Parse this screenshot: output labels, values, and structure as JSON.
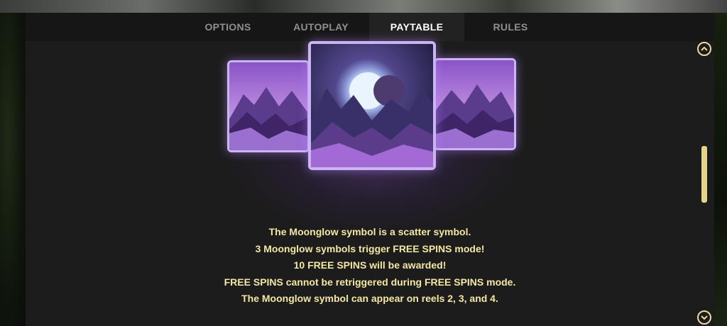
{
  "tabs": [
    {
      "label": "OPTIONS",
      "active": false
    },
    {
      "label": "AUTOPLAY",
      "active": false
    },
    {
      "label": "PAYTABLE",
      "active": true
    },
    {
      "label": "RULES",
      "active": false
    }
  ],
  "paytable": {
    "symbol_icon": "moonglow-scatter-symbol",
    "description": [
      "The Moonglow symbol is a scatter symbol.",
      "3 Moonglow symbols trigger FREE SPINS mode!",
      "10 FREE SPINS will be awarded!",
      "FREE SPINS cannot be retriggered during FREE SPINS mode.",
      "The Moonglow symbol can appear on reels 2, 3, and 4."
    ]
  },
  "scrollbar": {
    "up_icon": "chevron-up-icon",
    "down_icon": "chevron-down-icon"
  },
  "colors": {
    "text_gold": "#f3e7a3",
    "scroll_accent": "#e6d48a",
    "frame_lavender": "#c9b6f0"
  }
}
